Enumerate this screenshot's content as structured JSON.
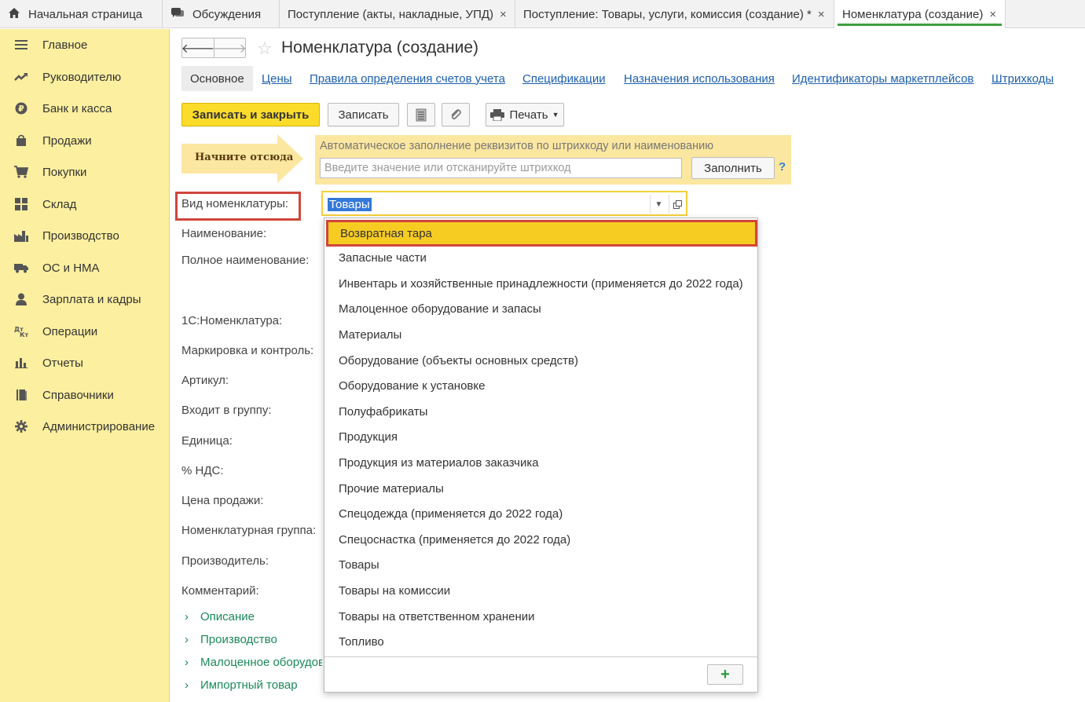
{
  "tabs": [
    {
      "label": "Начальная страница",
      "icon": "home-icon"
    },
    {
      "label": "Обсуждения",
      "icon": "chat-icon"
    },
    {
      "label": "Поступление (акты, накладные, УПД)",
      "close": "×"
    },
    {
      "label": "Поступление: Товары, услуги, комиссия (создание) *",
      "close": "×"
    },
    {
      "label": "Номенклатура (создание)",
      "close": "×"
    }
  ],
  "sidebar": {
    "items": [
      {
        "label": "Главное",
        "icon": "menu-lines-icon"
      },
      {
        "label": "Руководителю",
        "icon": "trend-icon"
      },
      {
        "label": "Банк и касса",
        "icon": "ruble-coin-icon"
      },
      {
        "label": "Продажи",
        "icon": "bag-icon"
      },
      {
        "label": "Покупки",
        "icon": "cart-icon"
      },
      {
        "label": "Склад",
        "icon": "warehouse-grid-icon"
      },
      {
        "label": "Производство",
        "icon": "factory-icon"
      },
      {
        "label": "ОС и НМА",
        "icon": "truck-icon"
      },
      {
        "label": "Зарплата и кадры",
        "icon": "person-icon"
      },
      {
        "label": "Операции",
        "icon": "dt-kt-icon"
      },
      {
        "label": "Отчеты",
        "icon": "bar-chart-icon"
      },
      {
        "label": "Справочники",
        "icon": "book-icon"
      },
      {
        "label": "Администрирование",
        "icon": "gear-icon"
      }
    ]
  },
  "form": {
    "title": "Номенклатура (создание)",
    "back": "🡐",
    "forward": "🡒",
    "tabs": [
      "Основное",
      "Цены",
      "Правила определения счетов учета",
      "Спецификации",
      "Назначения использования",
      "Идентификаторы маркетплейсов",
      "Штрихкоды"
    ],
    "toolbar": {
      "save_close": "Записать и закрыть",
      "save": "Записать",
      "print": "Печать"
    },
    "start_here": "Начните отсюда",
    "autofill": {
      "hint": "Автоматическое заполнение реквизитов по штрихкоду или наименованию",
      "placeholder": "Введите значение или отсканируйте штрихкод",
      "fill": "Заполнить",
      "help": "?"
    },
    "fields": {
      "kind": "Вид номенклатуры:",
      "kind_value": "Товары",
      "name": "Наименование:",
      "full_name": "Полное наименование:",
      "onec": "1С:Номенклатура:",
      "marking": "Маркировка и контроль:",
      "article": "Артикул:",
      "group": "Входит в группу:",
      "unit": "Единица:",
      "vat": "% НДС:",
      "price": "Цена продажи:",
      "nom_group": "Номенклатурная группа:",
      "manufacturer": "Производитель:",
      "comment": "Комментарий:"
    },
    "groups": [
      "Описание",
      "Производство",
      "Малоценное оборудование",
      "Импортный товар"
    ]
  },
  "dropdown": {
    "items": [
      "Возвратная тара",
      "Запасные части",
      "Инвентарь и хозяйственные принадлежности (применяется до 2022 года)",
      "Малоценное оборудование и запасы",
      "Материалы",
      "Оборудование (объекты основных средств)",
      "Оборудование к установке",
      "Полуфабрикаты",
      "Продукция",
      "Продукция из материалов заказчика",
      "Прочие материалы",
      "Спецодежда (применяется до 2022 года)",
      "Спецоснастка (применяется до 2022 года)",
      "Товары",
      "Товары на комиссии",
      "Товары на ответственном хранении",
      "Топливо"
    ],
    "selected_index": 0,
    "add": "+"
  }
}
